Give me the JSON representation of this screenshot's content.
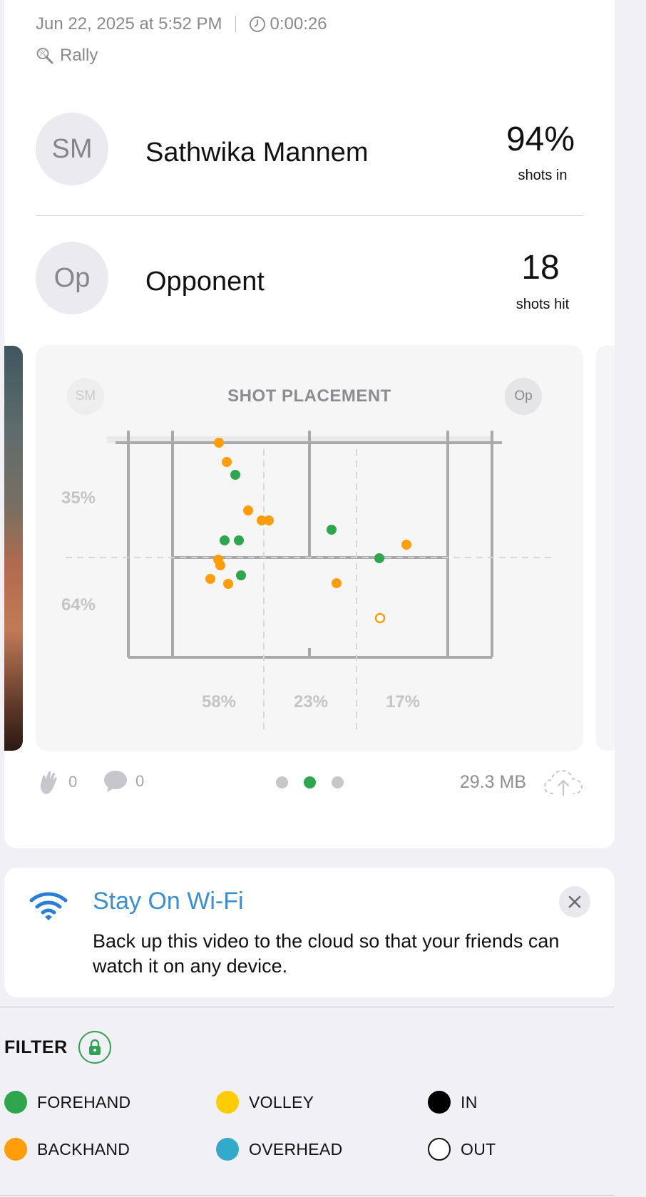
{
  "session": {
    "datetime": "Jun 22, 2025 at 5:52 PM",
    "duration": "0:00:26",
    "type": "Rally",
    "icons": {
      "clock": "clock-icon",
      "racket": "racket-icon"
    }
  },
  "players": [
    {
      "initials": "SM",
      "name": "Sathwika Mannem",
      "stat_value": "94%",
      "stat_label": "shots in"
    },
    {
      "initials": "Op",
      "name": "Opponent",
      "stat_value": "18",
      "stat_label": "shots hit"
    }
  ],
  "placement": {
    "title": "SHOT PLACEMENT",
    "left_initials": "SM",
    "right_initials": "Op",
    "depth_pcts": [
      "35%",
      "64%"
    ],
    "width_pcts": [
      "58%",
      "23%",
      "17%"
    ],
    "colors": {
      "forehand": "#2ea64e",
      "backhand": "#ff9d0a"
    },
    "shots": [
      {
        "kind": "backhand",
        "in": true
      },
      {
        "kind": "backhand",
        "in": true
      },
      {
        "kind": "forehand",
        "in": true
      },
      {
        "kind": "backhand",
        "in": true
      },
      {
        "kind": "backhand",
        "in": true
      },
      {
        "kind": "backhand",
        "in": true
      },
      {
        "kind": "forehand",
        "in": true
      },
      {
        "kind": "forehand",
        "in": true
      },
      {
        "kind": "forehand",
        "in": true
      },
      {
        "kind": "backhand",
        "in": true
      },
      {
        "kind": "backhand",
        "in": true
      },
      {
        "kind": "backhand",
        "in": true
      },
      {
        "kind": "backhand",
        "in": true
      },
      {
        "kind": "forehand",
        "in": true
      },
      {
        "kind": "backhand",
        "in": true
      },
      {
        "kind": "forehand",
        "in": true
      },
      {
        "kind": "backhand",
        "in": true
      },
      {
        "kind": "backhand",
        "in": false
      }
    ]
  },
  "footer": {
    "likes": "0",
    "comments": "0",
    "file_size": "29.3 MB",
    "pager": {
      "count": 3,
      "active": 1
    }
  },
  "wifi_banner": {
    "title": "Stay On Wi-Fi",
    "body": "Back up this video to the cloud so that your friends can watch it on any device.",
    "accent": "#3b8fd1"
  },
  "filter": {
    "title": "FILTER",
    "items": [
      {
        "label": "FOREHAND",
        "color": "#2ea64e"
      },
      {
        "label": "VOLLEY",
        "color": "#ffcc00"
      },
      {
        "label": "IN",
        "color": "#000000"
      },
      {
        "label": "BACKHAND",
        "color": "#ff9d0a"
      },
      {
        "label": "OVERHEAD",
        "color": "#34aacb"
      },
      {
        "label": "OUT",
        "color": "none"
      }
    ]
  }
}
